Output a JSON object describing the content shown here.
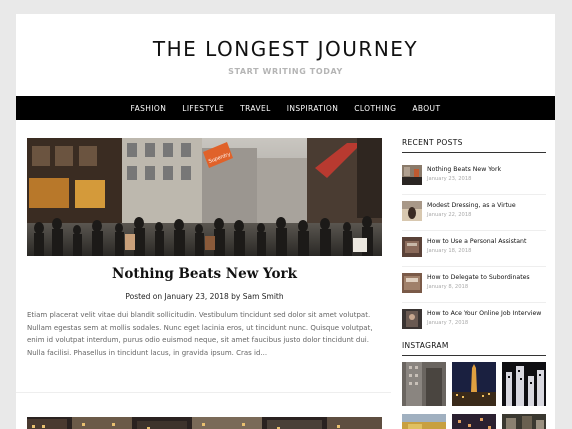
{
  "site": {
    "title": "THE LONGEST JOURNEY",
    "tagline": "START WRITING TODAY"
  },
  "nav": [
    "FASHION",
    "LIFESTYLE",
    "TRAVEL",
    "INSPIRATION",
    "CLOTHING",
    "ABOUT"
  ],
  "featured_post": {
    "title": "Nothing Beats New York",
    "meta_prefix": "Posted on",
    "date": "January 23, 2018",
    "meta_by": "by",
    "author": "Sam Smith",
    "excerpt": "Etiam placerat velit vitae dui blandit sollicitudin. Vestibulum tincidunt sed dolor sit amet volutpat. Nullam egestas sem at mollis sodales. Nunc eget lacinia eros, ut tincidunt nunc. Quisque volutpat, enim id volutpat interdum, purus odio euismod neque, sit amet faucibus justo dolor tincidunt dui. Nulla facilisi. Phasellus in tincidunt lacus, in gravida ipsum. Cras id...",
    "store_sign": "Superdry"
  },
  "sidebar": {
    "recent_title": "RECENT POSTS",
    "recent_posts": [
      {
        "title": "Nothing Beats New York",
        "date": "January 23, 2018"
      },
      {
        "title": "Modest Dressing, as a Virtue",
        "date": "January 22, 2018"
      },
      {
        "title": "How to Use a Personal Assistant",
        "date": "January 18, 2018"
      },
      {
        "title": "How to Delegate to Subordinates",
        "date": "January 8, 2018"
      },
      {
        "title": "How to Ace Your Online Job Interview",
        "date": "January 7, 2018"
      }
    ],
    "instagram_title": "INSTAGRAM"
  }
}
